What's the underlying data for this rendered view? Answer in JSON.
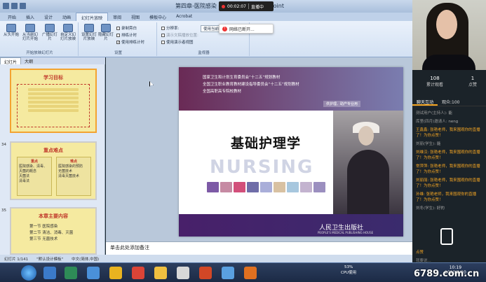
{
  "titlebar": {
    "doc_title": "第四章-医院感染 — Microsoft PowerPoint",
    "live_time": "00:02:07",
    "live_label": "直播中"
  },
  "tabs": [
    "开始",
    "插入",
    "设计",
    "动画",
    "幻灯片放映",
    "审阅",
    "视图",
    "模板中心",
    "Acrobat"
  ],
  "active_tab": "幻灯片放映",
  "ribbon": {
    "group1": {
      "label": "开始放映幻灯片",
      "buttons": [
        "从头开始",
        "从当前幻灯片开始",
        "广播幻灯片",
        "自定义幻灯片放映"
      ]
    },
    "group2": {
      "label": "设置",
      "buttons": [
        "设置幻灯片放映",
        "隐藏幻灯片"
      ],
      "checks": [
        "录制旁白",
        "排练计时",
        "使用排练计时"
      ]
    },
    "group3": {
      "label": "监视器",
      "items": [
        "分辨率:",
        "演示文稿播放位置:",
        "使用演示者视图"
      ],
      "resolution_value": "使用当前"
    }
  },
  "toast": "网络已断开...",
  "leftpane": {
    "tabs": [
      "幻灯片",
      "大纲"
    ],
    "slides": [
      {
        "num": "",
        "title": "学习目标"
      },
      {
        "num": "34",
        "title": "重点难点",
        "col1": "重点",
        "col2": "难点",
        "col1_items": [
          "医院感染、清毒、灭菌的概念",
          "灭菌法",
          "清毒法"
        ],
        "col2_items": [
          "医院感染的预防",
          "无菌技术",
          "清毒灭菌技术"
        ]
      },
      {
        "num": "35",
        "title": "本章主要内容",
        "toc": [
          "第一节  医院感染",
          "第二节  清洁、消毒、灭菌",
          "第三节  无菌技术"
        ]
      }
    ]
  },
  "slide": {
    "lines": [
      "国家卫生和计划生育委员会“十二五”规划教材",
      "全国卫生职业教育教材建设指导委员会“十二五”规划教材",
      "全国高职高专院校教材"
    ],
    "tag": "供护理、助产专业用",
    "title": "基础护理学",
    "nursing": "NURSING",
    "publisher": "人民卫生出版社",
    "publisher_en": "PEOPLE'S MEDICAL PUBLISHING HOUSE"
  },
  "notes_placeholder": "单击此处添加备注",
  "status": {
    "slide": "幻灯片 1/141",
    "theme": "\"默认设计模板\"",
    "lang": "中文(简体,中国)"
  },
  "right": {
    "stats": [
      {
        "n": "108",
        "l": "累计观看"
      },
      {
        "n": "1",
        "l": "点赞"
      }
    ],
    "rtabs": [
      "聊天互动",
      "观众:100"
    ],
    "chat": [
      {
        "u": "测试用户(主持人):",
        "t": "能",
        "hl": false
      },
      {
        "u": "库里(四月)邀请人:",
        "t": "neng",
        "hl": false
      },
      {
        "u": "王鑫鑫:",
        "t": "张艳老师，我来围观你的直播了！为你点赞！",
        "hl": true
      },
      {
        "u": "刘丽(学生):",
        "t": "能",
        "hl": false
      },
      {
        "u": "刘维汉:",
        "t": "张艳老师，我来围观你的直播了！为你点赞！",
        "hl": true
      },
      {
        "u": "常萍萍:",
        "t": "张艳老师，我来围观你的直播了！为你点赞！",
        "hl": true
      },
      {
        "u": "刘丽丽:",
        "t": "张艳老师，我来围观你的直播了！为你点赞！",
        "hl": true
      },
      {
        "u": "孙维:",
        "t": "张艳老师，我来围观你的直播了！为你点赞！",
        "hl": true
      },
      {
        "u": "刘冬(学生):",
        "t": "好的",
        "hl": false
      }
    ],
    "input_placeholder": "我要说...",
    "like": "点赞"
  },
  "taskbar": {
    "cpu": "53%",
    "cpu_label": "CPU使用",
    "time": "10:19",
    "date": "2020/2/20"
  },
  "watermark": "6789.com.cn"
}
